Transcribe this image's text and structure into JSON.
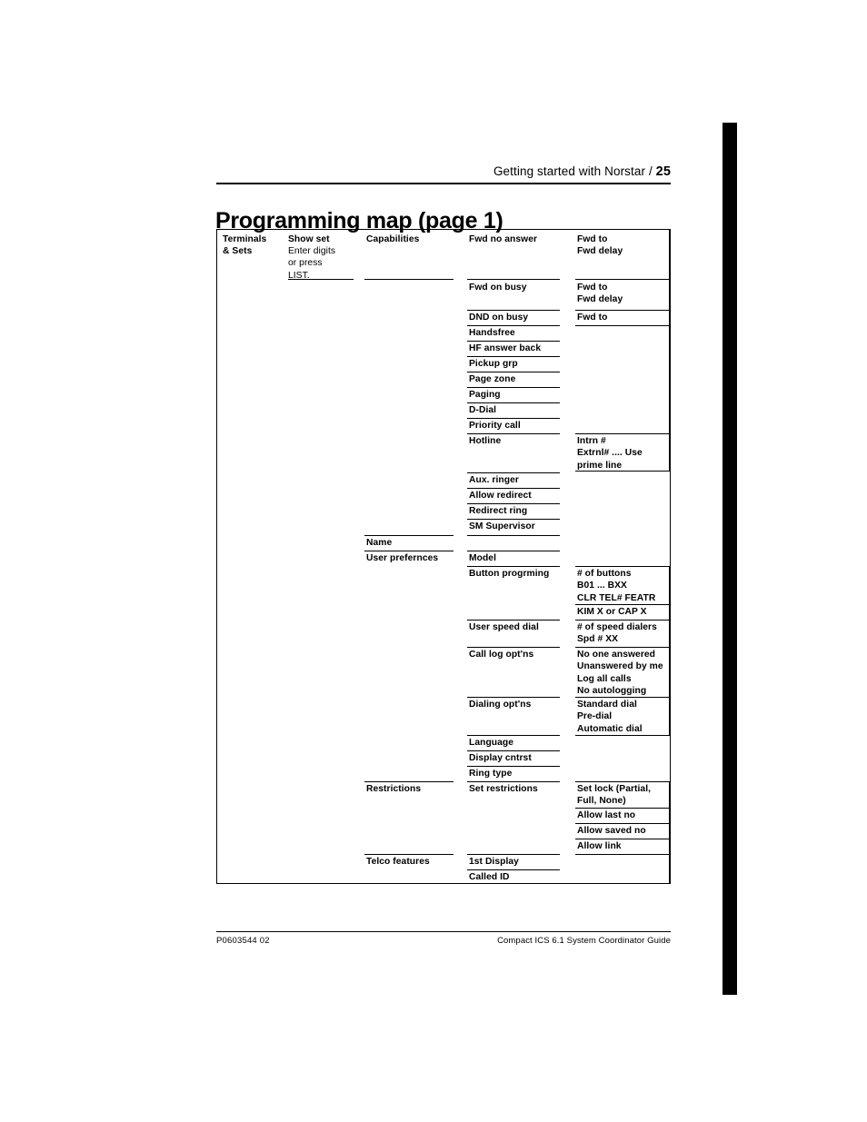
{
  "header": {
    "chapter": "Getting started with Norstar",
    "separator": "/",
    "page_number": "25"
  },
  "page_title": "Programming map (page 1)",
  "footer": {
    "left": "P0603544   02",
    "right": "Compact ICS 6.1 System Coordinator Guide"
  },
  "map": {
    "col1": {
      "heading": "Terminals\n& Sets"
    },
    "col2": {
      "heading": "Show set",
      "note": "Enter digits\nor press\nLIST."
    },
    "col3": {
      "items": [
        {
          "label": "Capabilities"
        },
        {
          "label": "Name"
        },
        {
          "label": "User prefernces"
        },
        {
          "label": "Restrictions"
        },
        {
          "label": "Telco features"
        }
      ]
    },
    "col4": {
      "items": [
        {
          "label": "Fwd no answer"
        },
        {
          "label": "Fwd on busy"
        },
        {
          "label": "DND on busy"
        },
        {
          "label": "Handsfree"
        },
        {
          "label": "HF answer back"
        },
        {
          "label": "Pickup grp"
        },
        {
          "label": "Page zone"
        },
        {
          "label": "Paging"
        },
        {
          "label": "D-Dial"
        },
        {
          "label": "Priority call"
        },
        {
          "label": "Hotline"
        },
        {
          "label": "Aux. ringer"
        },
        {
          "label": "Allow redirect"
        },
        {
          "label": "Redirect ring"
        },
        {
          "label": "SM Supervisor"
        },
        {
          "label": "Model"
        },
        {
          "label": "Button progrming"
        },
        {
          "label": "User speed dial"
        },
        {
          "label": "Call log opt'ns"
        },
        {
          "label": "Dialing opt'ns"
        },
        {
          "label": "Language"
        },
        {
          "label": "Display cntrst"
        },
        {
          "label": "Ring type"
        },
        {
          "label": "Set restrictions"
        },
        {
          "label": "1st Display"
        },
        {
          "label": "Called ID"
        }
      ]
    },
    "col5": {
      "items": [
        {
          "label": "Fwd to\nFwd delay"
        },
        {
          "label": "Fwd to\nFwd delay"
        },
        {
          "label": "Fwd to"
        },
        {
          "label": "Intrn #\nExtrnl# .... Use\nprime line"
        },
        {
          "label": "# of buttons\nB01 ... BXX\nCLR  TEL#  FEATR"
        },
        {
          "label": "KIM X or CAP X"
        },
        {
          "label": "# of speed dialers\nSpd # XX"
        },
        {
          "label": "No one answered\nUnanswered by me\nLog all calls\nNo autologging"
        },
        {
          "label": "Standard dial\nPre-dial\nAutomatic dial"
        },
        {
          "label": "Set lock (Partial,\nFull, None)"
        },
        {
          "label": "Allow last no"
        },
        {
          "label": "Allow saved no"
        },
        {
          "label": "Allow link"
        }
      ]
    }
  }
}
